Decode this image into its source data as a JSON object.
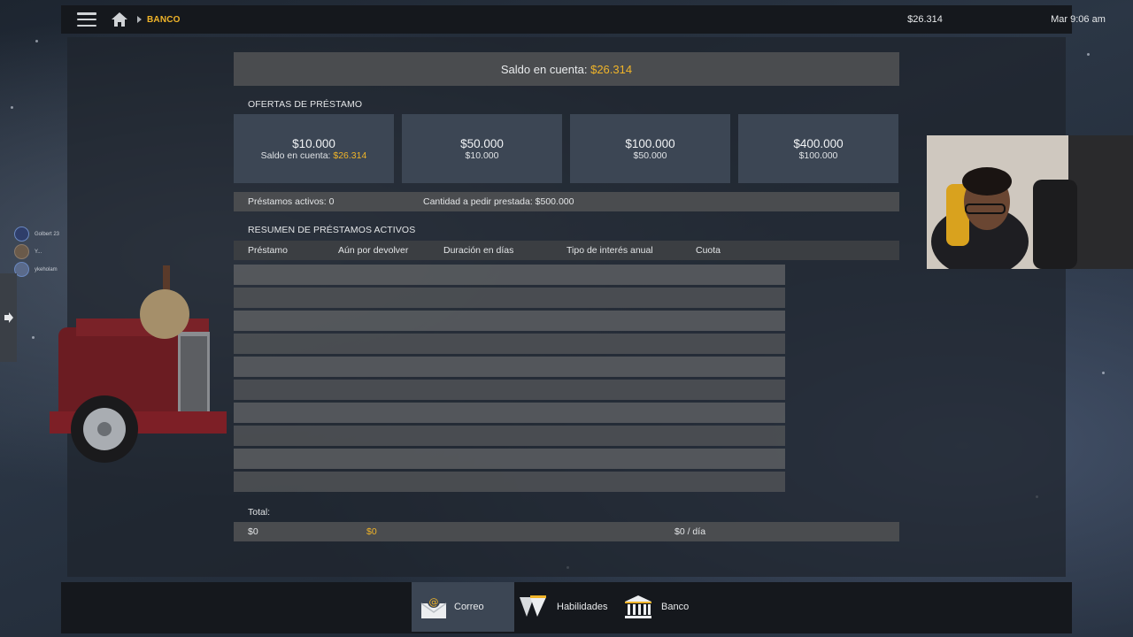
{
  "topbar": {
    "breadcrumb": "BANCO",
    "money": "$26.314",
    "time": "Mar 9:06 am"
  },
  "balance": {
    "label": "Saldo en cuenta:",
    "value": "$26.314"
  },
  "offers_section": {
    "title": "OFERTAS DE PRÉSTAMO",
    "offers": [
      {
        "amount": "$10.000",
        "sub_label": "Saldo en cuenta:",
        "sub_value": "$26.314"
      },
      {
        "amount": "$50.000",
        "sub_value": "$10.000"
      },
      {
        "amount": "$100.000",
        "sub_value": "$50.000"
      },
      {
        "amount": "$400.000",
        "sub_value": "$100.000"
      }
    ]
  },
  "info": {
    "active_loans": "Préstamos activos: 0",
    "borrow_amount": "Cantidad a pedir prestada: $500.000"
  },
  "summary": {
    "title": "RESUMEN DE PRÉSTAMOS ACTIVOS",
    "columns": [
      "Préstamo",
      "Aún por devolver",
      "Duración en días",
      "Tipo de interés anual",
      "Cuota"
    ],
    "rows": []
  },
  "total": {
    "label": "Total:",
    "loan": "$0",
    "remaining": "$0",
    "installment": "$0 / día"
  },
  "dock": {
    "items": [
      {
        "label": "Correo",
        "icon": "mail-icon",
        "active": true
      },
      {
        "label": "Habilidades",
        "icon": "skills-icon",
        "active": false
      },
      {
        "label": "Banco",
        "icon": "bank-icon",
        "active": false
      }
    ]
  },
  "friends": [
    {
      "name": "Golbert 23"
    },
    {
      "name": "Y..."
    },
    {
      "name": "ykeholam"
    }
  ],
  "colors": {
    "accent": "#f0b429",
    "panel_bar": "#4a4c4f",
    "offer_card": "#3c4654",
    "topbar": "#15181d"
  }
}
